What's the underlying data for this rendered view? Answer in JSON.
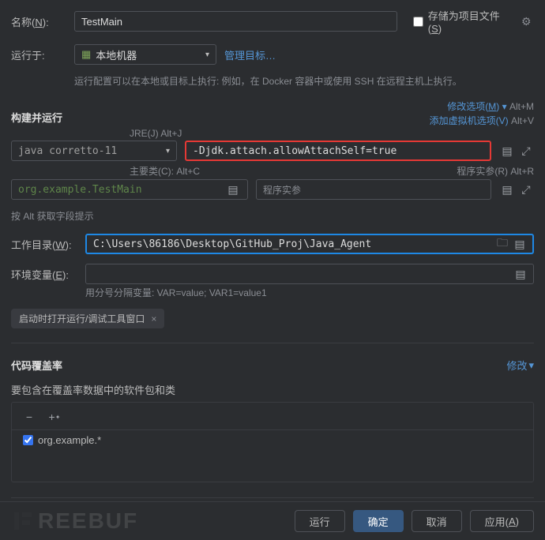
{
  "top": {
    "name_label_pre": "名称(",
    "name_label_u": "N",
    "name_label_post": "):",
    "name_value": "TestMain",
    "save_as_project_pre": "存储为项目文件(",
    "save_as_project_u": "S",
    "save_as_project_post": ")",
    "run_on_label": "运行于:",
    "run_on_value": "本地机器",
    "manage_targets": "管理目标…",
    "run_config_hint": "运行配置可以在本地或目标上执行: 例如，在 Docker 容器中或使用 SSH 在远程主机上执行。"
  },
  "build": {
    "section_title": "构建并运行",
    "modify_options_pre": "修改选项(",
    "modify_options_u": "M",
    "modify_options_post": ")",
    "modify_options_shortcut": "Alt+M",
    "add_vm_options": "添加虚拟机选项(V)",
    "add_vm_options_shortcut": "Alt+V",
    "jre_label": "JRE(J) Alt+J",
    "jdk_value": "java corretto-11",
    "vm_options_value": "-Djdk.attach.allowAttachSelf=true",
    "main_class_label": "主要类(C): Alt+C",
    "program_args_label": "程序实参(R) Alt+R",
    "main_class_value": "org.example.TestMain",
    "program_args_placeholder": "程序实参",
    "alt_hint": "按 Alt 获取字段提示",
    "work_dir_label_pre": "工作目录(",
    "work_dir_label_u": "W",
    "work_dir_label_post": "):",
    "work_dir_value": "C:\\Users\\86186\\Desktop\\GitHub_Proj\\Java_Agent",
    "env_label_pre": "环境变量(",
    "env_label_u": "E",
    "env_label_post": "):",
    "env_hint": "用分号分隔变量: VAR=value; VAR1=value1",
    "chip_label": "启动时打开运行/调试工具窗口"
  },
  "coverage": {
    "section_title": "代码覆盖率",
    "modify": "修改",
    "packages_label": "要包含在覆盖率数据中的软件包和类",
    "tree_item": "org.example.*"
  },
  "footer": {
    "run": "运行",
    "ok": "确定",
    "cancel": "取消",
    "apply_pre": "应用(",
    "apply_u": "A",
    "apply_post": ")"
  },
  "watermark": "REEBUF"
}
